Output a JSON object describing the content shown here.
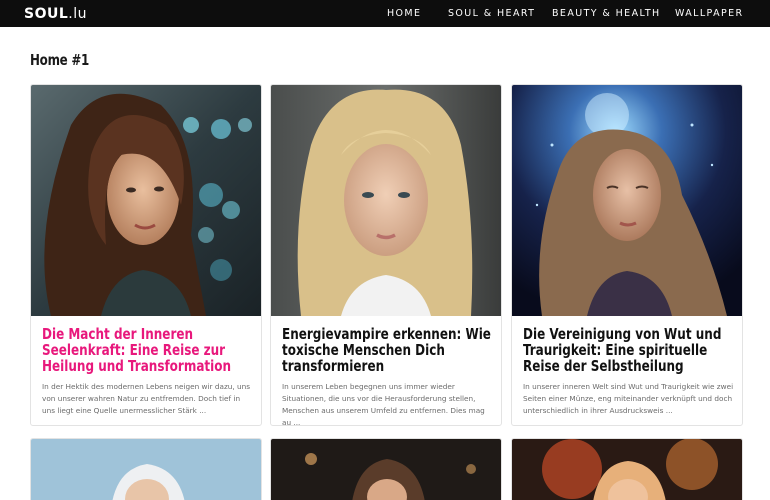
{
  "site": {
    "logo_bold": "SOUL",
    "logo_light": ".lu"
  },
  "nav": [
    {
      "label": "HOME"
    },
    {
      "label": "SOUL & HEART"
    },
    {
      "label": "BEAUTY & HEALTH"
    },
    {
      "label": "WALLPAPER"
    }
  ],
  "page_title": "Home #1",
  "posts": [
    {
      "title": "Die Macht der Inneren Seelenkraft: Eine Reise zur Heilung und Transformation",
      "excerpt": "In der Hektik des modernen Lebens neigen wir dazu, uns von unserer wahren Natur zu entfremden. Doch tief in uns liegt eine Quelle unermesslicher Stärk ...",
      "title_color": "#e8187c"
    },
    {
      "title": "Energievampire erkennen: Wie toxische Menschen Dich transformieren",
      "excerpt": "In unserem Leben begegnen uns immer wieder Situationen, die uns vor die Herausforderung stellen, Menschen aus unserem Umfeld zu entfernen. Dies mag au ...",
      "title_color": "#111111"
    },
    {
      "title": "Die Vereinigung von Wut und Traurigkeit: Eine spirituelle Reise der Selbstheilung",
      "excerpt": "In unserer inneren Welt sind Wut und Traurigkeit wie zwei Seiten einer Münze, eng miteinander verknüpft und doch unterschiedlich in ihrer Ausdrucksweis ...",
      "title_color": "#111111"
    }
  ],
  "colors": {
    "topbar": "#0d0d0d",
    "accent": "#e8187c",
    "text": "#111111",
    "muted": "#6b6b6b"
  }
}
